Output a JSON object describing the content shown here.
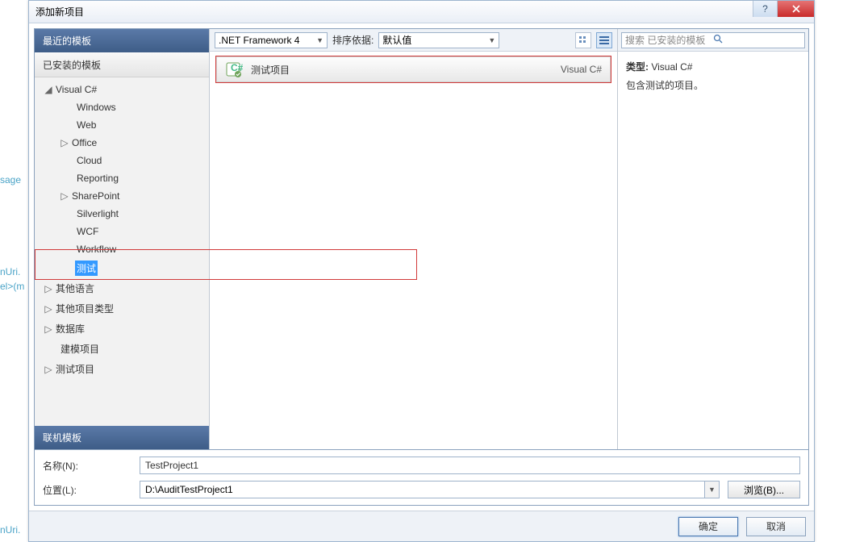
{
  "leaks": {
    "sage": "sage",
    "nUri1": "nUri.",
    "el": "el>(m",
    "nUri2": "nUri."
  },
  "titlebar": {
    "title": "添加新项目",
    "help": "?"
  },
  "sidebar": {
    "recent": "最近的模板",
    "installed": "已安装的模板",
    "online": "联机模板",
    "tree": {
      "visual_csharp": "Visual C#",
      "windows": "Windows",
      "web": "Web",
      "office": "Office",
      "cloud": "Cloud",
      "reporting": "Reporting",
      "sharepoint": "SharePoint",
      "silverlight": "Silverlight",
      "wcf": "WCF",
      "workflow": "Workflow",
      "test": "测试",
      "other_lang": "其他语言",
      "other_proj": "其他项目类型",
      "database": "数据库",
      "modeling": "建模项目",
      "test_proj": "测试项目"
    }
  },
  "toolbar": {
    "framework": ".NET Framework 4",
    "sort_label": "排序依据:",
    "sort_value": "默认值"
  },
  "template": {
    "name": "测试项目",
    "lang": "Visual C#"
  },
  "right": {
    "search_placeholder": "搜索 已安装的模板",
    "type_prefix": "类型:",
    "type_value": "Visual C#",
    "desc": "包含测试的项目。"
  },
  "fields": {
    "name_label": "名称(N):",
    "name_value": "TestProject1",
    "loc_label": "位置(L):",
    "loc_value": "D:\\AuditTestProject1",
    "browse": "浏览(B)..."
  },
  "footer": {
    "ok": "确定",
    "cancel": "取消"
  }
}
